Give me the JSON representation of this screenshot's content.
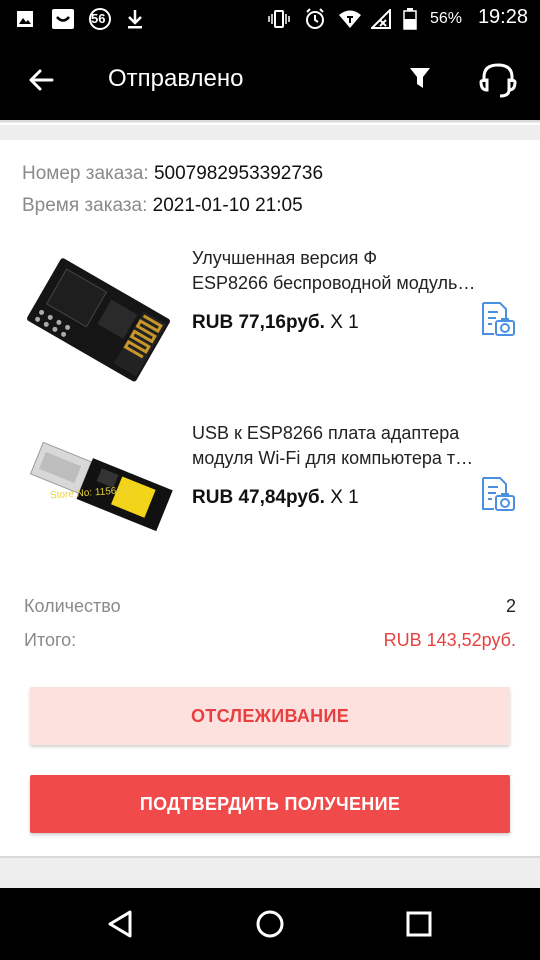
{
  "status_bar": {
    "notification_count": "56",
    "battery_percent": "56%",
    "time": "19:28"
  },
  "app_bar": {
    "title": "Отправлено"
  },
  "order": {
    "number_label": "Номер заказа:",
    "number_value": "5007982953392736",
    "time_label": "Время заказа:",
    "time_value": "2021-01-10 21:05"
  },
  "products": [
    {
      "title_line1": "Улучшенная версия Ф",
      "title_line2": "ESP8266 беспроводной модуль…",
      "price": "RUB 77,16руб.",
      "qty": "X 1"
    },
    {
      "title_line1": "USB к ESP8266 плата адаптера",
      "title_line2": "модуля Wi-Fi для компьютера т…",
      "price": "RUB 47,84руб.",
      "qty": "X 1",
      "image_watermark": "Store No: 1156412"
    }
  ],
  "summary": {
    "quantity_label": "Количество",
    "quantity_value": "2",
    "total_label": "Итого:",
    "total_value": "RUB 143,52руб."
  },
  "buttons": {
    "track": "ОТСЛЕЖИВАНИЕ",
    "confirm": "ПОДТВЕРДИТЬ ПОЛУЧЕНИЕ"
  },
  "colors": {
    "accent_red": "#f04a4a",
    "price_red": "#e84040",
    "icon_blue": "#4a90e2"
  },
  "icons": {
    "back": "arrow-left-icon",
    "filter": "filter-icon",
    "support": "headset-icon",
    "photo": "photo-review-icon",
    "nav_back": "triangle-back-icon",
    "nav_home": "circle-home-icon",
    "nav_recent": "square-recent-icon"
  }
}
